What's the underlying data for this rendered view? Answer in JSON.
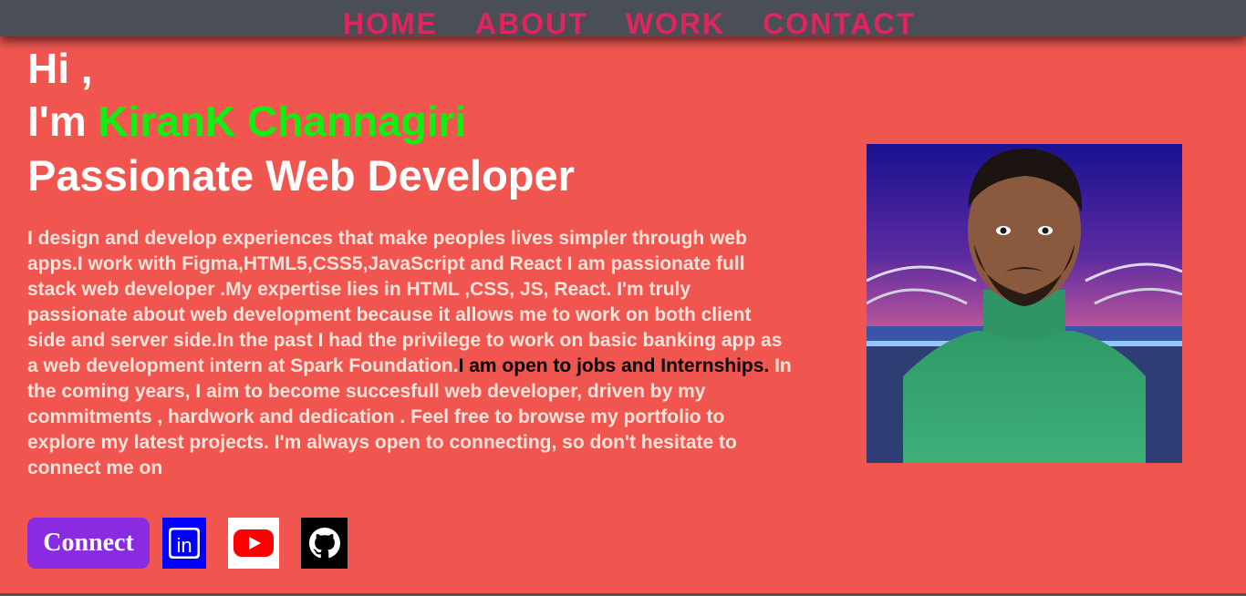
{
  "nav": {
    "items": [
      "HOME",
      "ABOUT",
      "WORK",
      "CONTACT"
    ]
  },
  "hero": {
    "greeting": "Hi ,",
    "intro_prefix": "I'm ",
    "name": "KiranK Channagiri",
    "headline": "Passionate Web Developer",
    "bio_part1": "I design and develop experiences that make peoples lives simpler through web apps.I work with Figma,HTML5,CSS5,JavaScript and React I am passionate full stack web developer .My expertise lies in HTML ,CSS, JS, React. I'm truly passionate about web development because it allows me to work on both client side and server side.In the past I had the privilege to work on basic banking app as a web development intern at Spark Foundation.",
    "bio_highlight": "I am open to jobs and Internships.",
    "bio_part2": " In the coming years, I aim to become succesfull web developer, driven by my commitments , hardwork and dedication . Feel free to browse my portfolio to explore my latest projects. I'm always open to connecting, so don't hesitate to connect me on"
  },
  "actions": {
    "connect_label": "Connect",
    "linkedin_glyph": "in",
    "icons": [
      "linkedin-icon",
      "youtube-icon",
      "github-icon"
    ]
  },
  "colors": {
    "background": "#f0564f",
    "navbar": "#4a4f55",
    "nav_text": "#e0245e",
    "name": "#11ee11",
    "bio_text": "#fde3da",
    "connect_button": "#8a2be2",
    "linkedin": "#0000ff",
    "youtube_red": "#ff0000",
    "github": "#000000"
  }
}
